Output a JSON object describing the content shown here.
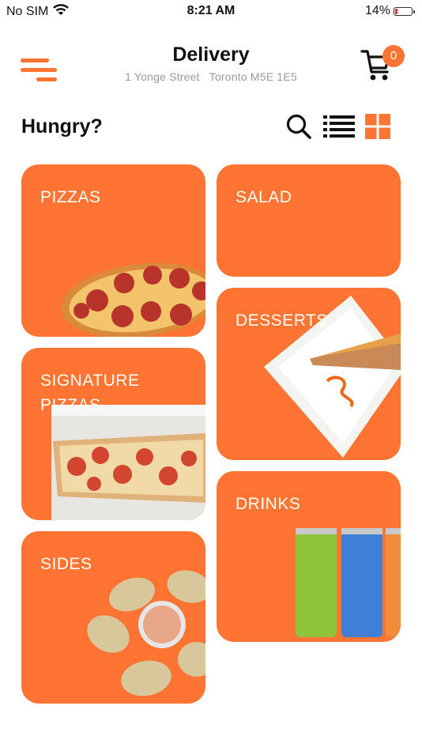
{
  "status_bar": {
    "carrier": "No SIM",
    "time": "8:21 AM",
    "battery_percent": "14%",
    "battery_level": 0.14
  },
  "header": {
    "title": "Delivery",
    "address": "1 Yonge Street   Toronto M5E 1E5",
    "cart_count": "0",
    "icons": {
      "menu": "menu-icon",
      "cart": "cart-icon"
    }
  },
  "toolbar": {
    "heading": "Hungry?",
    "icons": [
      "search-icon",
      "list-view-icon",
      "grid-view-icon"
    ],
    "active_view": "grid"
  },
  "categories": [
    {
      "label": "PIZZAS",
      "image": "pepperoni-pizza"
    },
    {
      "label": "SALAD",
      "image": ""
    },
    {
      "label": "DESSERTS",
      "image": "cheesecake-slice"
    },
    {
      "label": "SIGNATURE PIZZAS",
      "image": "tomato-flatbread-pizza"
    },
    {
      "label": "DRINKS",
      "image": "peace-tea-cans"
    },
    {
      "label": "SIDES",
      "image": "panzerotti-with-dip"
    }
  ],
  "colors": {
    "accent": "#ff7433",
    "text": "#111111",
    "muted": "#999999",
    "battery_low": "#e33333"
  }
}
